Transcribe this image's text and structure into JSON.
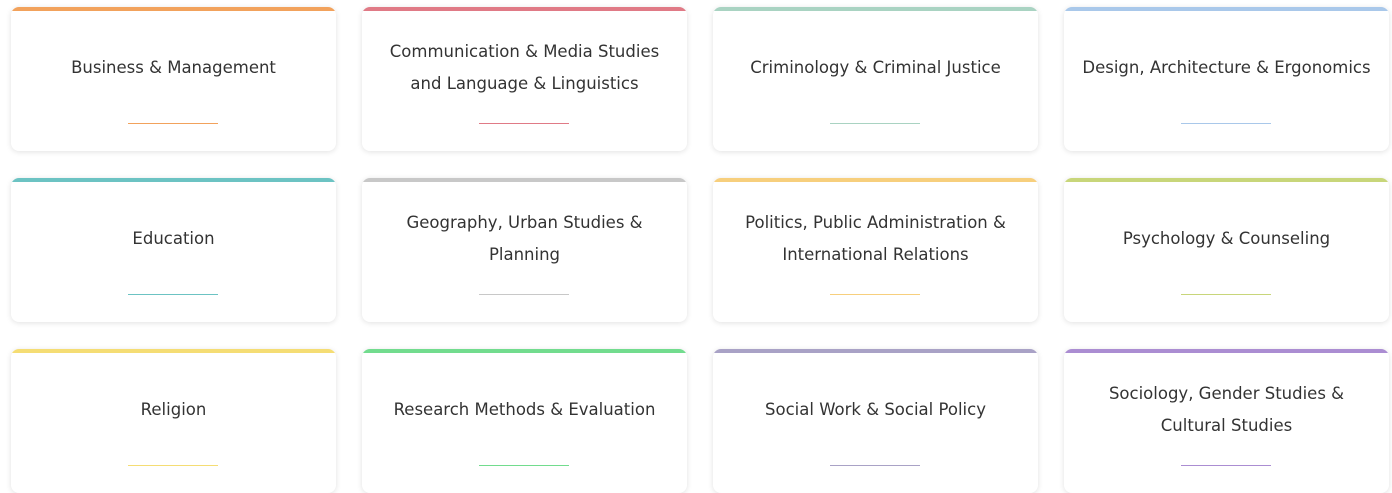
{
  "cards": [
    {
      "label": "Business & Management",
      "color": "#f2a25c"
    },
    {
      "label": "Communication & Media Studies and Language & Linguistics",
      "color": "#e07a86"
    },
    {
      "label": "Criminology & Criminal Justice",
      "color": "#a9d3c2"
    },
    {
      "label": "Design, Architecture & Ergonomics",
      "color": "#a9c8ea"
    },
    {
      "label": "Education",
      "color": "#6cc3c3"
    },
    {
      "label": "Geography, Urban Studies & Planning",
      "color": "#c8c8c8"
    },
    {
      "label": "Politics, Public Administration & International Relations",
      "color": "#f7cf7d"
    },
    {
      "label": "Psychology & Counseling",
      "color": "#c8d67a"
    },
    {
      "label": "Religion",
      "color": "#f5dd74"
    },
    {
      "label": "Research Methods & Evaluation",
      "color": "#72dc8e"
    },
    {
      "label": "Social Work & Social Policy",
      "color": "#a9a2c6"
    },
    {
      "label": "Sociology, Gender Studies & Cultural Studies",
      "color": "#ab8dd2"
    }
  ]
}
